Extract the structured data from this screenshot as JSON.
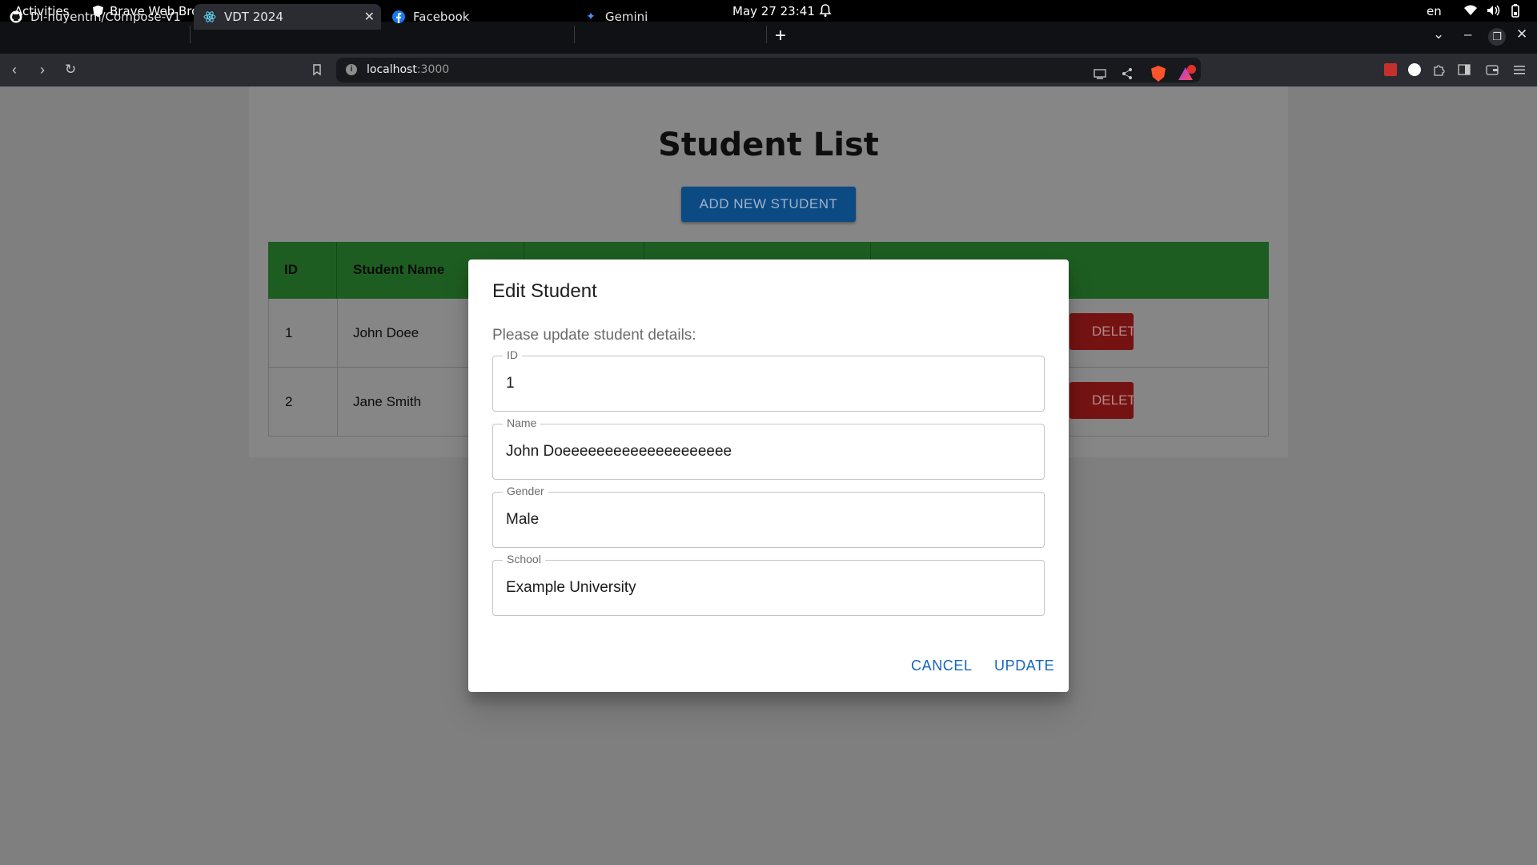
{
  "system": {
    "activities": "Activities",
    "app_name": "Brave Web Browser",
    "clock": "May 27  23:41",
    "lang": "en"
  },
  "tabs": [
    {
      "label": "DI-huyentm/Compose-V1",
      "icon": "github-icon"
    },
    {
      "label": "VDT 2024",
      "icon": "react-icon",
      "active": true
    },
    {
      "label": "Facebook",
      "icon": "facebook-icon"
    },
    {
      "label": "Gemini",
      "icon": "gemini-icon"
    }
  ],
  "address": {
    "host": "localhost",
    "port": ":3000"
  },
  "page": {
    "title": "Student List",
    "add_button": "ADD NEW STUDENT",
    "columns": {
      "id": "ID",
      "name": "Student Name"
    },
    "rows": [
      {
        "id": "1",
        "name": "John Doee",
        "delete_label": "DELETE"
      },
      {
        "id": "2",
        "name": "Jane Smith",
        "delete_label": "DELETE"
      }
    ]
  },
  "dialog": {
    "title": "Edit Student",
    "subtitle": "Please update student details:",
    "fields": {
      "id": {
        "label": "ID",
        "value": "1"
      },
      "name": {
        "label": "Name",
        "value": "John Doeeeeeeeeeeeeeeeeeeee"
      },
      "gender": {
        "label": "Gender",
        "value": "Male"
      },
      "school": {
        "label": "School",
        "value": "Example University"
      }
    },
    "cancel": "CANCEL",
    "update": "UPDATE"
  },
  "colors": {
    "table_header": "#1e5d21",
    "add_button": "#0c4a84",
    "delete_button": "#751313",
    "dialog_action": "#1565c0"
  }
}
